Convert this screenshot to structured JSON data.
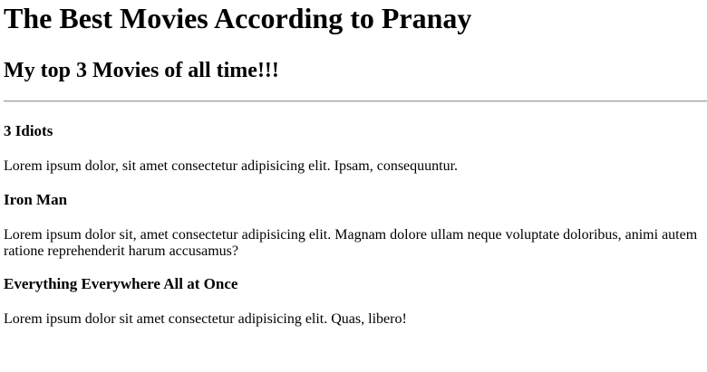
{
  "header": {
    "title": "The Best Movies According to Pranay",
    "subtitle": "My top 3 Movies of all time!!!"
  },
  "movies": [
    {
      "title": "3 Idiots",
      "description": "Lorem ipsum dolor, sit amet consectetur adipisicing elit. Ipsam, consequuntur."
    },
    {
      "title": "Iron Man",
      "description": "Lorem ipsum dolor sit, amet consectetur adipisicing elit. Magnam dolore ullam neque voluptate doloribus, animi autem ratione reprehenderit harum accusamus?"
    },
    {
      "title": "Everything Everywhere All at Once",
      "description": "Lorem ipsum dolor sit amet consectetur adipisicing elit. Quas, libero!"
    }
  ]
}
